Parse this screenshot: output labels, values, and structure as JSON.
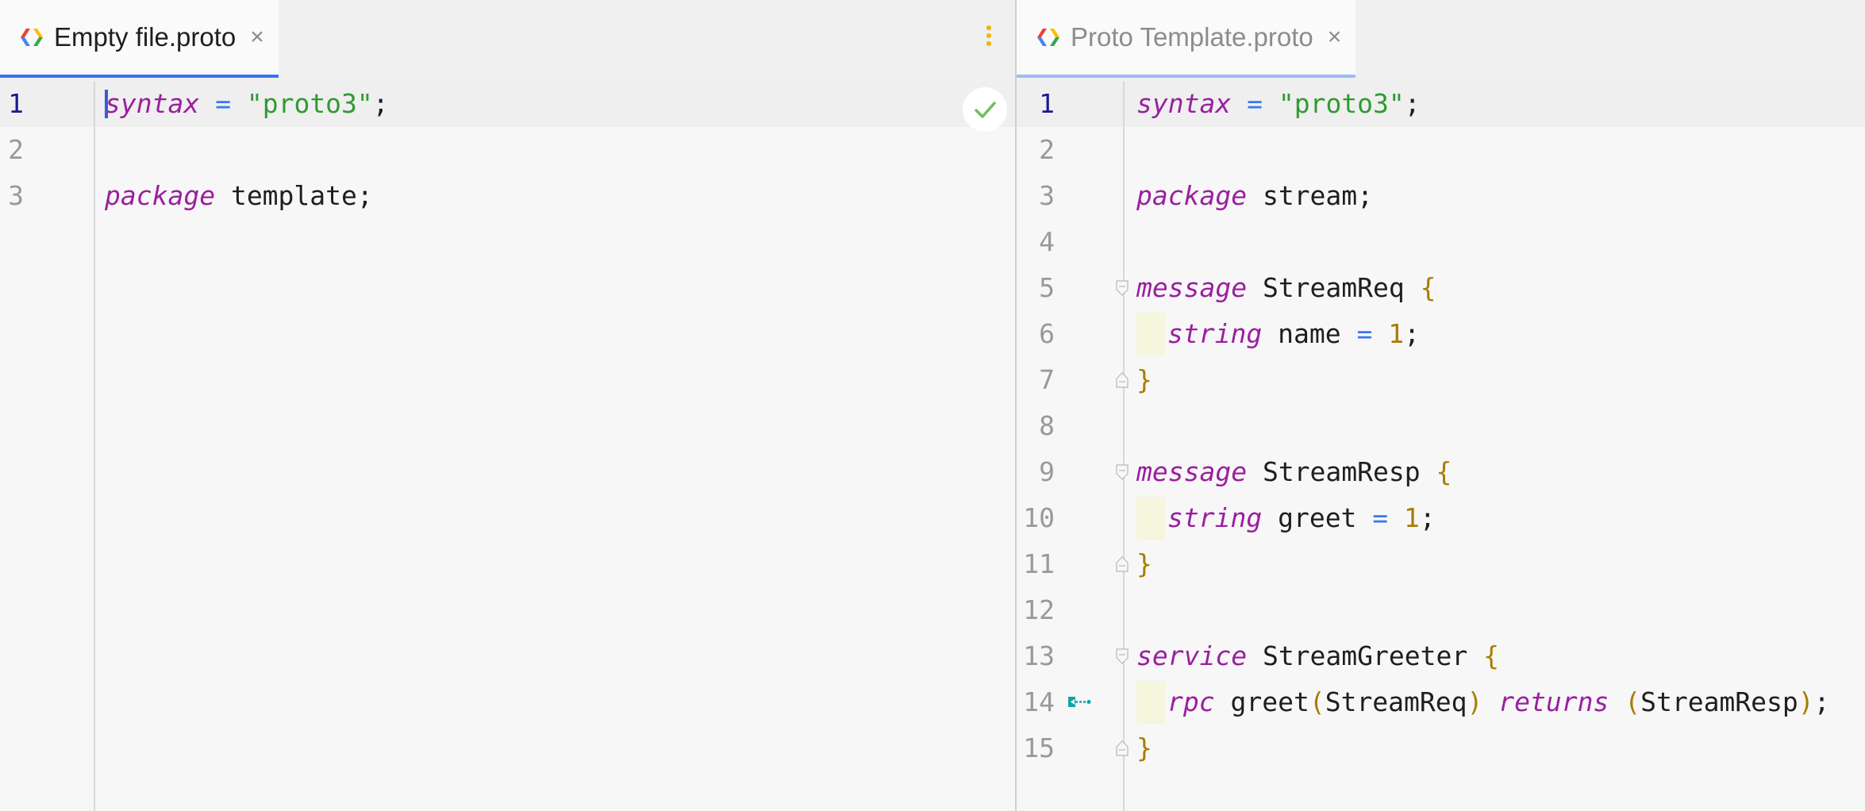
{
  "left_editor": {
    "tab": {
      "title": "Empty file.proto",
      "icon": "protobuf-file-icon"
    },
    "status_icon": "checkmark-icon",
    "lines": [
      {
        "n": "1",
        "tokens": [
          {
            "t": "syntax",
            "c": "kw",
            "caret": true
          },
          {
            "t": " "
          },
          {
            "t": "=",
            "c": "op"
          },
          {
            "t": " "
          },
          {
            "t": "\"proto3\"",
            "c": "str"
          },
          {
            "t": ";"
          }
        ]
      },
      {
        "n": "2",
        "tokens": []
      },
      {
        "n": "3",
        "tokens": [
          {
            "t": "package",
            "c": "kw"
          },
          {
            "t": " template;"
          }
        ]
      }
    ]
  },
  "right_editor": {
    "tab": {
      "title": "Proto Template.proto",
      "icon": "protobuf-file-icon"
    },
    "lines": [
      {
        "n": "1",
        "tokens": [
          {
            "t": "syntax",
            "c": "kw"
          },
          {
            "t": " "
          },
          {
            "t": "=",
            "c": "op"
          },
          {
            "t": " "
          },
          {
            "t": "\"proto3\"",
            "c": "str"
          },
          {
            "t": ";"
          }
        ]
      },
      {
        "n": "2",
        "tokens": []
      },
      {
        "n": "3",
        "tokens": [
          {
            "t": "package",
            "c": "kw"
          },
          {
            "t": " stream;"
          }
        ]
      },
      {
        "n": "4",
        "tokens": []
      },
      {
        "n": "5",
        "fold": "open",
        "tokens": [
          {
            "t": "message",
            "c": "kw"
          },
          {
            "t": " StreamReq "
          },
          {
            "t": "{",
            "c": "br"
          }
        ]
      },
      {
        "n": "6",
        "indent": true,
        "tokens": [
          {
            "t": "string",
            "c": "kw"
          },
          {
            "t": " name "
          },
          {
            "t": "=",
            "c": "op"
          },
          {
            "t": " "
          },
          {
            "t": "1",
            "c": "num"
          },
          {
            "t": ";"
          }
        ]
      },
      {
        "n": "7",
        "fold": "close",
        "tokens": [
          {
            "t": "}",
            "c": "br"
          }
        ]
      },
      {
        "n": "8",
        "tokens": []
      },
      {
        "n": "9",
        "fold": "open",
        "tokens": [
          {
            "t": "message",
            "c": "kw"
          },
          {
            "t": " StreamResp "
          },
          {
            "t": "{",
            "c": "br"
          }
        ]
      },
      {
        "n": "10",
        "indent": true,
        "tokens": [
          {
            "t": "string",
            "c": "kw"
          },
          {
            "t": " greet "
          },
          {
            "t": "=",
            "c": "op"
          },
          {
            "t": " "
          },
          {
            "t": "1",
            "c": "num"
          },
          {
            "t": ";"
          }
        ]
      },
      {
        "n": "11",
        "fold": "close",
        "tokens": [
          {
            "t": "}",
            "c": "br"
          }
        ]
      },
      {
        "n": "12",
        "tokens": []
      },
      {
        "n": "13",
        "fold": "open",
        "tokens": [
          {
            "t": "service",
            "c": "kw"
          },
          {
            "t": " StreamGreeter "
          },
          {
            "t": "{",
            "c": "br"
          }
        ]
      },
      {
        "n": "14",
        "indent": true,
        "marker": true,
        "tokens": [
          {
            "t": "rpc",
            "c": "kw"
          },
          {
            "t": " greet"
          },
          {
            "t": "(",
            "c": "br"
          },
          {
            "t": "StreamReq"
          },
          {
            "t": ")",
            "c": "br"
          },
          {
            "t": " "
          },
          {
            "t": "returns",
            "c": "kw"
          },
          {
            "t": " "
          },
          {
            "t": "(",
            "c": "br"
          },
          {
            "t": "StreamResp"
          },
          {
            "t": ")",
            "c": "br"
          },
          {
            "t": ";"
          }
        ]
      },
      {
        "n": "15",
        "fold": "close",
        "tokens": [
          {
            "t": "}",
            "c": "br"
          }
        ]
      }
    ]
  },
  "colors": {
    "keyword": "#9b1fa0",
    "string": "#2f9b30",
    "operator": "#3a76f0",
    "number": "#a97b00",
    "accent": "#3574f0"
  }
}
